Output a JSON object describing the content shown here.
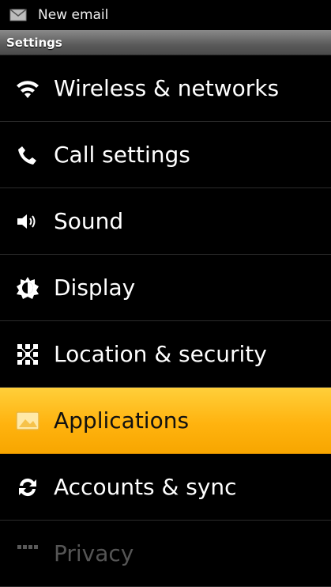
{
  "status_bar": {
    "notification_icon": "mail-icon",
    "notification_text": "New email"
  },
  "title_bar": {
    "title": "Settings"
  },
  "settings": {
    "items": [
      {
        "label": "Wireless & networks",
        "icon": "wifi-icon"
      },
      {
        "label": "Call settings",
        "icon": "phone-icon"
      },
      {
        "label": "Sound",
        "icon": "speaker-icon"
      },
      {
        "label": "Display",
        "icon": "brightness-icon"
      },
      {
        "label": "Location & security",
        "icon": "location-grid-icon"
      },
      {
        "label": "Applications",
        "icon": "applications-icon",
        "selected": true
      },
      {
        "label": "Accounts & sync",
        "icon": "sync-icon"
      },
      {
        "label": "Privacy",
        "icon": "privacy-icon"
      }
    ]
  },
  "colors": {
    "selected_highlight": "#ffb30f",
    "background": "#000000",
    "title_bar": "#5a5a5a"
  }
}
